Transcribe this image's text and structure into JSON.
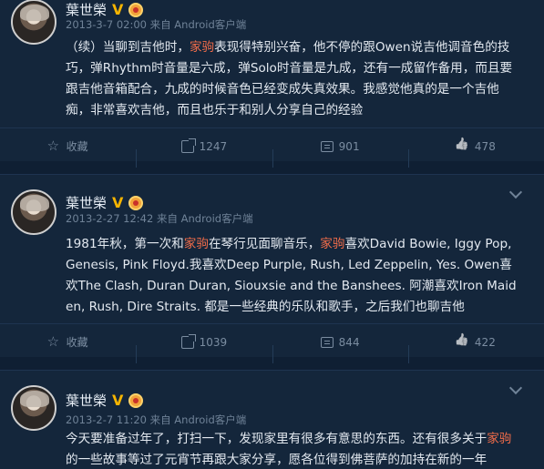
{
  "posts": [
    {
      "author": "葉世榮",
      "verified_mark": "V",
      "meta": "2013-3-7 02:00 来自 Android客户端",
      "text_parts": [
        {
          "t": "（续）当聊到吉他时，",
          "hl": false
        },
        {
          "t": "家驹",
          "hl": true
        },
        {
          "t": "表现得特别兴奋，他不停的跟Owen说吉他调音色的技巧，弹Rhythm时音量是六成，弹Solo时音量是九成，还有一成留作备用，而且要跟吉他音箱配合，九成的时候音色已经变成失真效果。我感觉他真的是一个吉他痴，非常喜欢吉他，而且也乐于和别人分享自己的经验",
          "hl": false
        }
      ],
      "actions": {
        "favorite": "收藏",
        "repost": "1247",
        "comment": "901",
        "like": "478"
      }
    },
    {
      "author": "葉世榮",
      "verified_mark": "V",
      "meta": "2013-2-27 12:42 来自 Android客户端",
      "text_parts": [
        {
          "t": "1981年秋，第一次和",
          "hl": false
        },
        {
          "t": "家驹",
          "hl": true
        },
        {
          "t": "在琴行见面聊音乐，",
          "hl": false
        },
        {
          "t": "家驹",
          "hl": true
        },
        {
          "t": "喜欢David Bowie, Iggy Pop, Genesis, Pink Floyd.我喜欢Deep Purple, Rush, Led Zeppelin, Yes. Owen喜欢The Clash, Duran Duran, Siouxsie and the Banshees. 阿潮喜欢Iron Maiden, Rush, Dire Straits. 都是一些经典的乐队和歌手，之后我们也聊吉他",
          "hl": false
        }
      ],
      "actions": {
        "favorite": "收藏",
        "repost": "1039",
        "comment": "844",
        "like": "422"
      }
    },
    {
      "author": "葉世榮",
      "verified_mark": "V",
      "meta": "2013-2-7 11:20 来自 Android客户端",
      "text_parts": [
        {
          "t": "今天要准备过年了，打扫一下，发现家里有很多有意思的东西。还有很多关于",
          "hl": false
        },
        {
          "t": "家驹",
          "hl": true
        },
        {
          "t": "的一些故事等过了元宵节再跟大家分享，愿各位得到佛菩萨的加持在新的一年",
          "hl": false
        }
      ]
    }
  ]
}
